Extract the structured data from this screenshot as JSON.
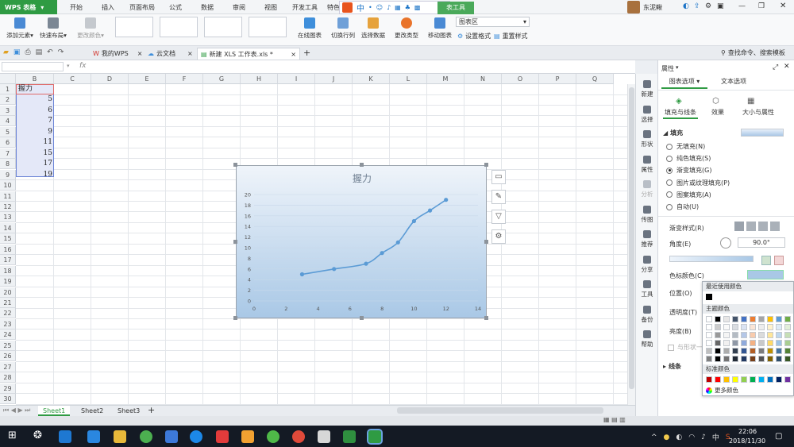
{
  "menu": {
    "app_name": "WPS 表格",
    "items": [
      "开始",
      "插入",
      "页面布局",
      "公式",
      "数据",
      "审阅",
      "视图",
      "开发工具",
      "特色"
    ],
    "chart_tools_tab": "表工具",
    "user_name": "东泥鳅"
  },
  "ribbon": {
    "add_element": "添加元素",
    "quick_layout": "快速布局",
    "change_color": "更改颜色",
    "online_chart": "在线图表",
    "switch_row_col": "切换行列",
    "select_data": "选择数据",
    "change_type": "更改类型",
    "move_chart": "移动图表",
    "chart_area_select": "图表区",
    "set_format": "设置格式",
    "reset_style": "重置样式"
  },
  "tabs": {
    "items": [
      "我的WPS",
      "云文档",
      "新建 XLS 工作表.xls *"
    ],
    "search_placeholder": "查找命令、搜索模板"
  },
  "formula": {
    "fx": "fx"
  },
  "sheet": {
    "columns": [
      "B",
      "C",
      "D",
      "E",
      "F",
      "G",
      "H",
      "I",
      "J",
      "K",
      "L",
      "M",
      "N",
      "O",
      "P",
      "Q"
    ],
    "rows": [
      "1",
      "2",
      "3",
      "4",
      "5",
      "6",
      "7",
      "8",
      "9",
      "10",
      "11",
      "12",
      "13",
      "14",
      "15",
      "16",
      "17",
      "18",
      "19",
      "20",
      "21",
      "22",
      "23",
      "24",
      "25",
      "26",
      "27",
      "28",
      "29",
      "30"
    ],
    "header_cell": "握力",
    "values": [
      "5",
      "6",
      "7",
      "9",
      "11",
      "15",
      "17",
      "19"
    ],
    "sheet_tabs": [
      "Sheet1",
      "Sheet2",
      "Sheet3"
    ],
    "add_sheet": "+"
  },
  "chart_data": {
    "type": "scatter",
    "title": "握力",
    "series": [
      {
        "x": [
          3,
          5,
          7,
          8,
          9,
          10,
          11,
          12
        ],
        "y": [
          5,
          6,
          7,
          9,
          11,
          15,
          17,
          19
        ]
      }
    ],
    "xlim": [
      0,
      14
    ],
    "ylim": [
      0,
      20
    ],
    "x_ticks": [
      "0",
      "2",
      "4",
      "6",
      "8",
      "10",
      "12",
      "14"
    ],
    "y_ticks": [
      "0",
      "2",
      "4",
      "6",
      "8",
      "10",
      "12",
      "14",
      "16",
      "18",
      "20"
    ],
    "smooth_line": true,
    "grid": true,
    "line_color": "#5b9bd5"
  },
  "vtools": [
    "新建",
    "选择",
    "形状",
    "属性",
    "分析",
    "传图",
    "推荐",
    "分享",
    "工具",
    "备份",
    "帮助"
  ],
  "panel": {
    "title": "属性",
    "tab_chart_options": "图表选项",
    "tab_text_options": "文本选项",
    "sub_fill_line": "填充与线条",
    "sub_effect": "效果",
    "sub_size": "大小与属性",
    "fill_section": "填充",
    "fill_options": [
      "无填充(N)",
      "纯色填充(S)",
      "渐变填充(G)",
      "图片或纹理填充(P)",
      "图案填充(A)",
      "自动(U)"
    ],
    "selected_fill": "渐变填充(G)",
    "gradient_style": "渐变样式(R)",
    "angle_label": "角度(E)",
    "angle_value": "90.0°",
    "stop_color": "色标颜色(C)",
    "position": "位置(O)",
    "transparency": "透明度(T)",
    "brightness": "亮度(B)",
    "with_shape": "与形状一",
    "line_section": "线条"
  },
  "palette": {
    "recent": "最近使用颜色",
    "theme": "主题颜色",
    "standard": "标准颜色",
    "more": "更多颜色",
    "theme_colors": [
      "#ffffff",
      "#000000",
      "#e7e6e6",
      "#44546a",
      "#4472c4",
      "#ed7d31",
      "#a5a5a5",
      "#ffc000",
      "#5b9bd5",
      "#70ad47"
    ],
    "standard_colors": [
      "#c00000",
      "#ff0000",
      "#ffc000",
      "#ffff00",
      "#92d050",
      "#00b050",
      "#00b0f0",
      "#0070c0",
      "#002060",
      "#7030a0"
    ]
  },
  "taskbar": {
    "time": "22:06",
    "date": "2018/11/30"
  }
}
